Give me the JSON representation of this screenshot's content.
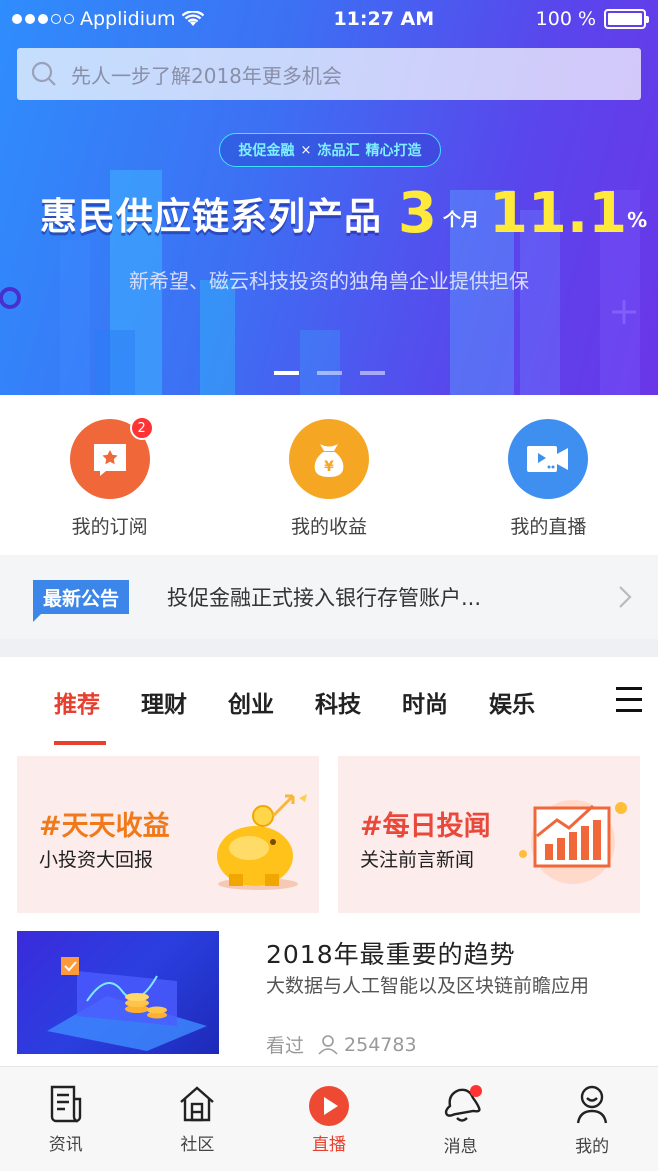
{
  "status_bar": {
    "carrier": "Applidium",
    "time": "11:27 AM",
    "battery": "100 %"
  },
  "search": {
    "placeholder": "先人一步了解2018年更多机会"
  },
  "banner": {
    "tag_left": "投促金融",
    "tag_sep": "×",
    "tag_mid": "冻品汇",
    "tag_right": "精心打造",
    "headline": "惠民供应链系列产品",
    "term_number": "3",
    "term_unit": "个月",
    "rate_number": "11.1",
    "rate_unit": "%",
    "subline": "新希望、磁云科技投资的独角兽企业提供担保",
    "pages": 3,
    "active_page": 0
  },
  "quick_entries": [
    {
      "label": "我的订阅",
      "icon": "subscription-icon",
      "color": "#f0673a",
      "badge": "2"
    },
    {
      "label": "我的收益",
      "icon": "money-bag-icon",
      "color": "#f5a623"
    },
    {
      "label": "我的直播",
      "icon": "video-icon",
      "color": "#3f8ff0"
    }
  ],
  "notice": {
    "tag": "最新公告",
    "text": "投促金融正式接入银行存管账户..."
  },
  "tabs": [
    "推荐",
    "理财",
    "创业",
    "科技",
    "时尚",
    "娱乐"
  ],
  "active_tab": 0,
  "promo_cards": [
    {
      "title": "#天天收益",
      "subtitle": "小投资大回报",
      "title_color": "#f07a1a"
    },
    {
      "title": "#每日投闻",
      "subtitle": "关注前言新闻",
      "title_color": "#e9493a"
    }
  ],
  "article": {
    "title": "2018年最重要的趋势",
    "description": "大数据与人工智能以及区块链前瞻应用",
    "viewed_label": "看过",
    "views": "254783"
  },
  "bottom_nav": [
    {
      "label": "资讯",
      "icon": "news-icon"
    },
    {
      "label": "社区",
      "icon": "community-icon"
    },
    {
      "label": "直播",
      "icon": "live-play-icon"
    },
    {
      "label": "消息",
      "icon": "bell-icon",
      "dot": true
    },
    {
      "label": "我的",
      "icon": "profile-icon"
    }
  ],
  "active_nav": 2,
  "colors": {
    "accent": "#e8402f",
    "notice_tag": "#3b86e8"
  }
}
